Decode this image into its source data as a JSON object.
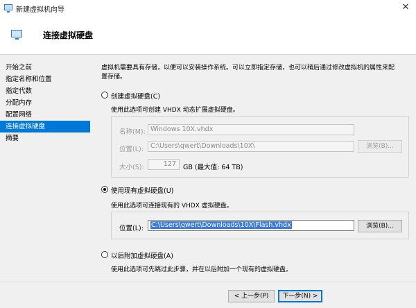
{
  "window": {
    "title": "新建虚拟机向导",
    "close_glyph": "✕"
  },
  "header": {
    "title": "连接虚拟硬盘"
  },
  "nav": {
    "items": [
      {
        "label": "开始之前",
        "active": false
      },
      {
        "label": "指定名称和位置",
        "active": false
      },
      {
        "label": "指定代数",
        "active": false
      },
      {
        "label": "分配内存",
        "active": false
      },
      {
        "label": "配置网络",
        "active": false
      },
      {
        "label": "连接虚拟硬盘",
        "active": true
      },
      {
        "label": "摘要",
        "active": false
      }
    ]
  },
  "main": {
    "description_line1": "虚拟机需要具有存储，以便可以安装操作系统。可以立即指定存储，也可以稍后通过修改虚拟机的属性来配",
    "description_line2": "置存储。",
    "option_create": {
      "label": "创建虚拟硬盘(C)",
      "help": "使用此选项可创建 VHDX 动态扩展虚拟硬盘。",
      "selected": false,
      "name_label": "名称(M):",
      "name_value": "Windows 10X.vhdx",
      "location_label": "位置(L):",
      "location_value": "C:\\Users\\qwert\\Downloads\\10X\\",
      "browse_label": "浏览(B)...",
      "size_label": "大小(S):",
      "size_value": "127",
      "size_unit": "GB (最大值: 64 TB)"
    },
    "option_existing": {
      "label": "使用现有虚拟硬盘(U)",
      "help": "使用此选项可连接现有的 VHDX 虚拟硬盘。",
      "selected": true,
      "location_label": "位置(L):",
      "location_value": "C:\\Users\\qwert\\Downloads\\10X\\Flash.vhdx",
      "browse_label": "浏览(B)..."
    },
    "option_later": {
      "label": "以后附加虚拟硬盘(A)",
      "help": "使用此选项可先跳过此步骤，并在以后附加一个现有的虚拟硬盘。",
      "selected": false
    }
  },
  "footer": {
    "prev_label": "< 上一步(P)",
    "next_label": "下一步(N) >"
  },
  "colors": {
    "accent": "#0078d7",
    "selection": "#3a7bd5"
  }
}
